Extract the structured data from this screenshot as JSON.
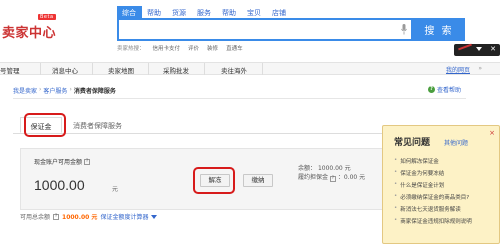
{
  "header": {
    "logo_text": "卖家中心",
    "logo_badge": "Beta",
    "search_tabs": [
      "综合",
      "帮助",
      "货源",
      "服务",
      "帮助",
      "宝贝",
      "店铺"
    ],
    "search_placeholder": "",
    "search_button": "搜 索",
    "hot_label": "卖家热搜：",
    "hot_links": [
      "信用卡支付",
      "评价",
      "装修",
      "直通车"
    ]
  },
  "nav": {
    "items": [
      "号管理",
      "消息中心",
      "卖家地图",
      "采购批发",
      "卖往海外"
    ],
    "my_site": "我的网页",
    "more": "»"
  },
  "breadcrumb": {
    "items": [
      "我是卖家",
      "客户服务"
    ],
    "current": "消费者保障服务",
    "separator": "›"
  },
  "help_link": "查看帮助",
  "tabs": [
    "保证金",
    "消费者保障服务"
  ],
  "panel": {
    "available_label": "现金账户可用金额",
    "amount": "1000.00",
    "amount_unit": "元",
    "unfreeze_button": "解冻",
    "pay_button": "缴纳",
    "balance_label": "余额：",
    "balance_value": "1000.00 元",
    "frozen_label": "履约担保金",
    "frozen_value": "：0.00 元"
  },
  "bottom": {
    "label": "可用总余额",
    "value": "1000.00 元",
    "calc_link": "保证金额度计算器"
  },
  "faq": {
    "title": "常见问题",
    "subtitle": "其他问题",
    "close": "×",
    "items": [
      "如何解冻保证金",
      "保证金为何要冻结",
      "什么是保证金计划",
      "必须缴纳保证金的商品类目?",
      "新消法七天退货服务解读",
      "商家保证金违规扣除规则说明"
    ]
  },
  "colors": {
    "accent": "#3a8be8",
    "annotation": "#d71b1b",
    "faq_bg": "#fdf2c6",
    "link": "#3366cc"
  }
}
